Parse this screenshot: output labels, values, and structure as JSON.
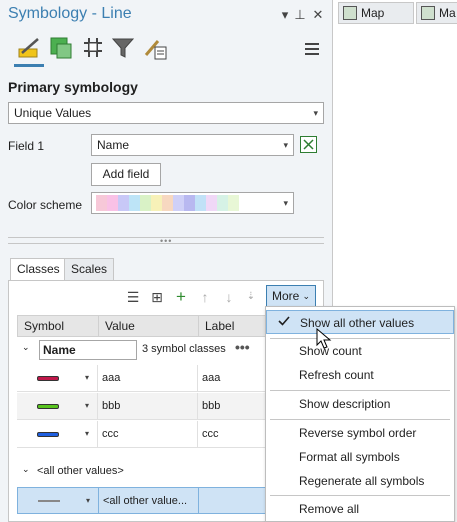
{
  "pane": {
    "title": "Symbology - Line",
    "title_buttons": {
      "dropdown": "▾",
      "pin": "⊥",
      "close": "✕"
    },
    "tools": [
      "primary-symbology",
      "vary-symbology",
      "symbol-layers",
      "filter",
      "label-classes"
    ],
    "primary_symbology_heading": "Primary symbology",
    "renderer_value": "Unique Values",
    "field1_label": "Field 1",
    "field1_value": "Name",
    "add_field_label": "Add field",
    "color_scheme_label": "Color scheme",
    "color_scheme_colors": [
      "#f7c8d8",
      "#f9c1e6",
      "#c8c8f7",
      "#bde4f7",
      "#d9f2c6",
      "#f7f1b8",
      "#f7d8c0",
      "#cfd0f7",
      "#b8b8f0",
      "#c1e1f7",
      "#f0d8f7",
      "#d6f2e6",
      "#e8f7d6"
    ]
  },
  "tabs": [
    {
      "label": "Classes",
      "active": true
    },
    {
      "label": "Scales",
      "active": false
    }
  ],
  "classes_toolbar": {
    "more_label": "More"
  },
  "grid": {
    "headers": [
      "Symbol",
      "Value",
      "Label"
    ],
    "group_field": "Name",
    "group_count_text": "3 symbol classes",
    "rows": [
      {
        "value": "aaa",
        "label": "aaa",
        "color": "#c0184a"
      },
      {
        "value": "bbb",
        "label": "bbb",
        "color": "#58c41e"
      },
      {
        "value": "ccc",
        "label": "ccc",
        "color": "#1f5fe0"
      }
    ],
    "other_group_label": "<all other values>",
    "other_row_value": "<all other value...",
    "other_row_color": "#888888"
  },
  "more_menu": {
    "items": [
      {
        "label": "Show all other values",
        "checked": true
      },
      {
        "label": "Show count"
      },
      {
        "label": "Refresh count"
      },
      {
        "label": "Show description"
      },
      {
        "label": "Reverse symbol order"
      },
      {
        "label": "Format all symbols"
      },
      {
        "label": "Regenerate all symbols"
      },
      {
        "label": "Remove all"
      }
    ]
  },
  "map_tabs": [
    {
      "label": "Map"
    },
    {
      "label": "Ma"
    }
  ]
}
